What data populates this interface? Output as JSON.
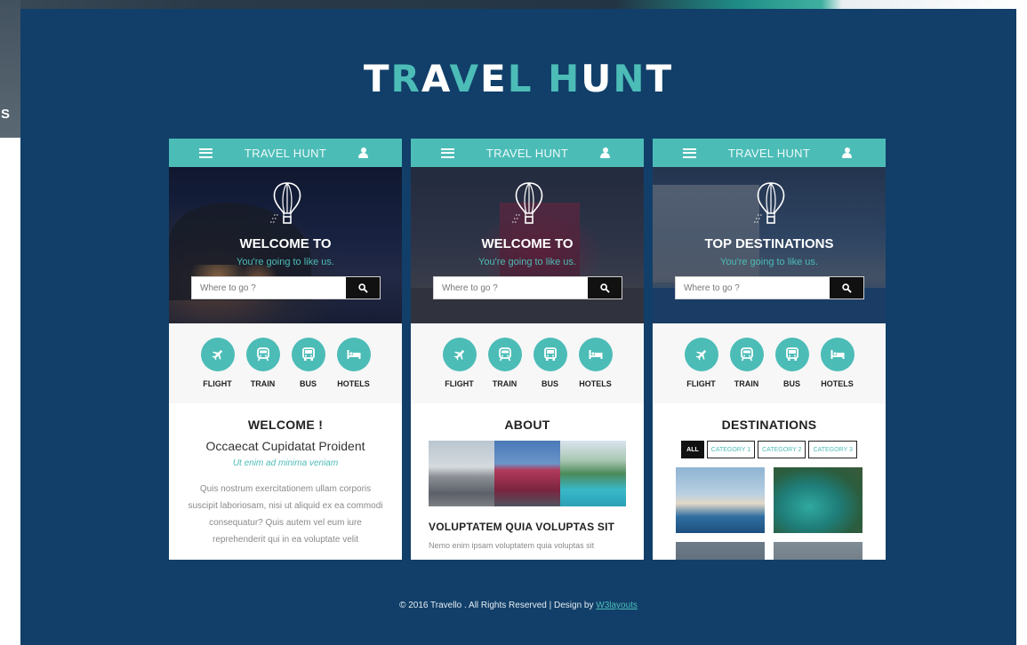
{
  "background_page": {
    "partial_text": "S"
  },
  "site": {
    "title": "TRAVEL HUNT",
    "footer_prefix": "© 2016 Travello . All Rights Reserved | Design by ",
    "footer_link": "W3layouts"
  },
  "colors": {
    "navy": "#113f69",
    "teal": "#4cbcb7",
    "dark": "#111111",
    "white": "#ffffff"
  },
  "cards": [
    {
      "topbar_title": "TRAVEL HUNT",
      "hero_title": "WELCOME TO",
      "hero_subtitle": "You're going to like us.",
      "search_placeholder": "Where to go ?",
      "services": [
        "FLIGHT",
        "TRAIN",
        "BUS",
        "HOTELS"
      ],
      "section_title": "WELCOME !",
      "subtitle": "Occaecat Cupidatat Proident",
      "em_text": "Ut enim ad minima veniam",
      "paragraph": "Quis nostrum exercitationem ullam corporis suscipit laboriosam, nisi ut aliquid ex ea commodi consequatur? Quis autem vel eum iure reprehenderit qui in ea voluptate velit"
    },
    {
      "topbar_title": "TRAVEL HUNT",
      "hero_title": "WELCOME TO",
      "hero_subtitle": "You're going to like us.",
      "search_placeholder": "Where to go ?",
      "services": [
        "FLIGHT",
        "TRAIN",
        "BUS",
        "HOTELS"
      ],
      "section_title": "ABOUT",
      "heading": "VOLUPTATEM QUIA VOLUPTAS SIT",
      "text": "Nemo enim ipsam voluptatem quia voluptas sit"
    },
    {
      "topbar_title": "TRAVEL HUNT",
      "hero_title": "TOP DESTINATIONS",
      "hero_subtitle": "You're going to like us.",
      "search_placeholder": "Where to go ?",
      "services": [
        "FLIGHT",
        "TRAIN",
        "BUS",
        "HOTELS"
      ],
      "section_title": "DESTINATIONS",
      "categories": [
        "ALL",
        "CATEGORY 1",
        "CATEGORY 2",
        "CATEGORY 3"
      ]
    }
  ]
}
